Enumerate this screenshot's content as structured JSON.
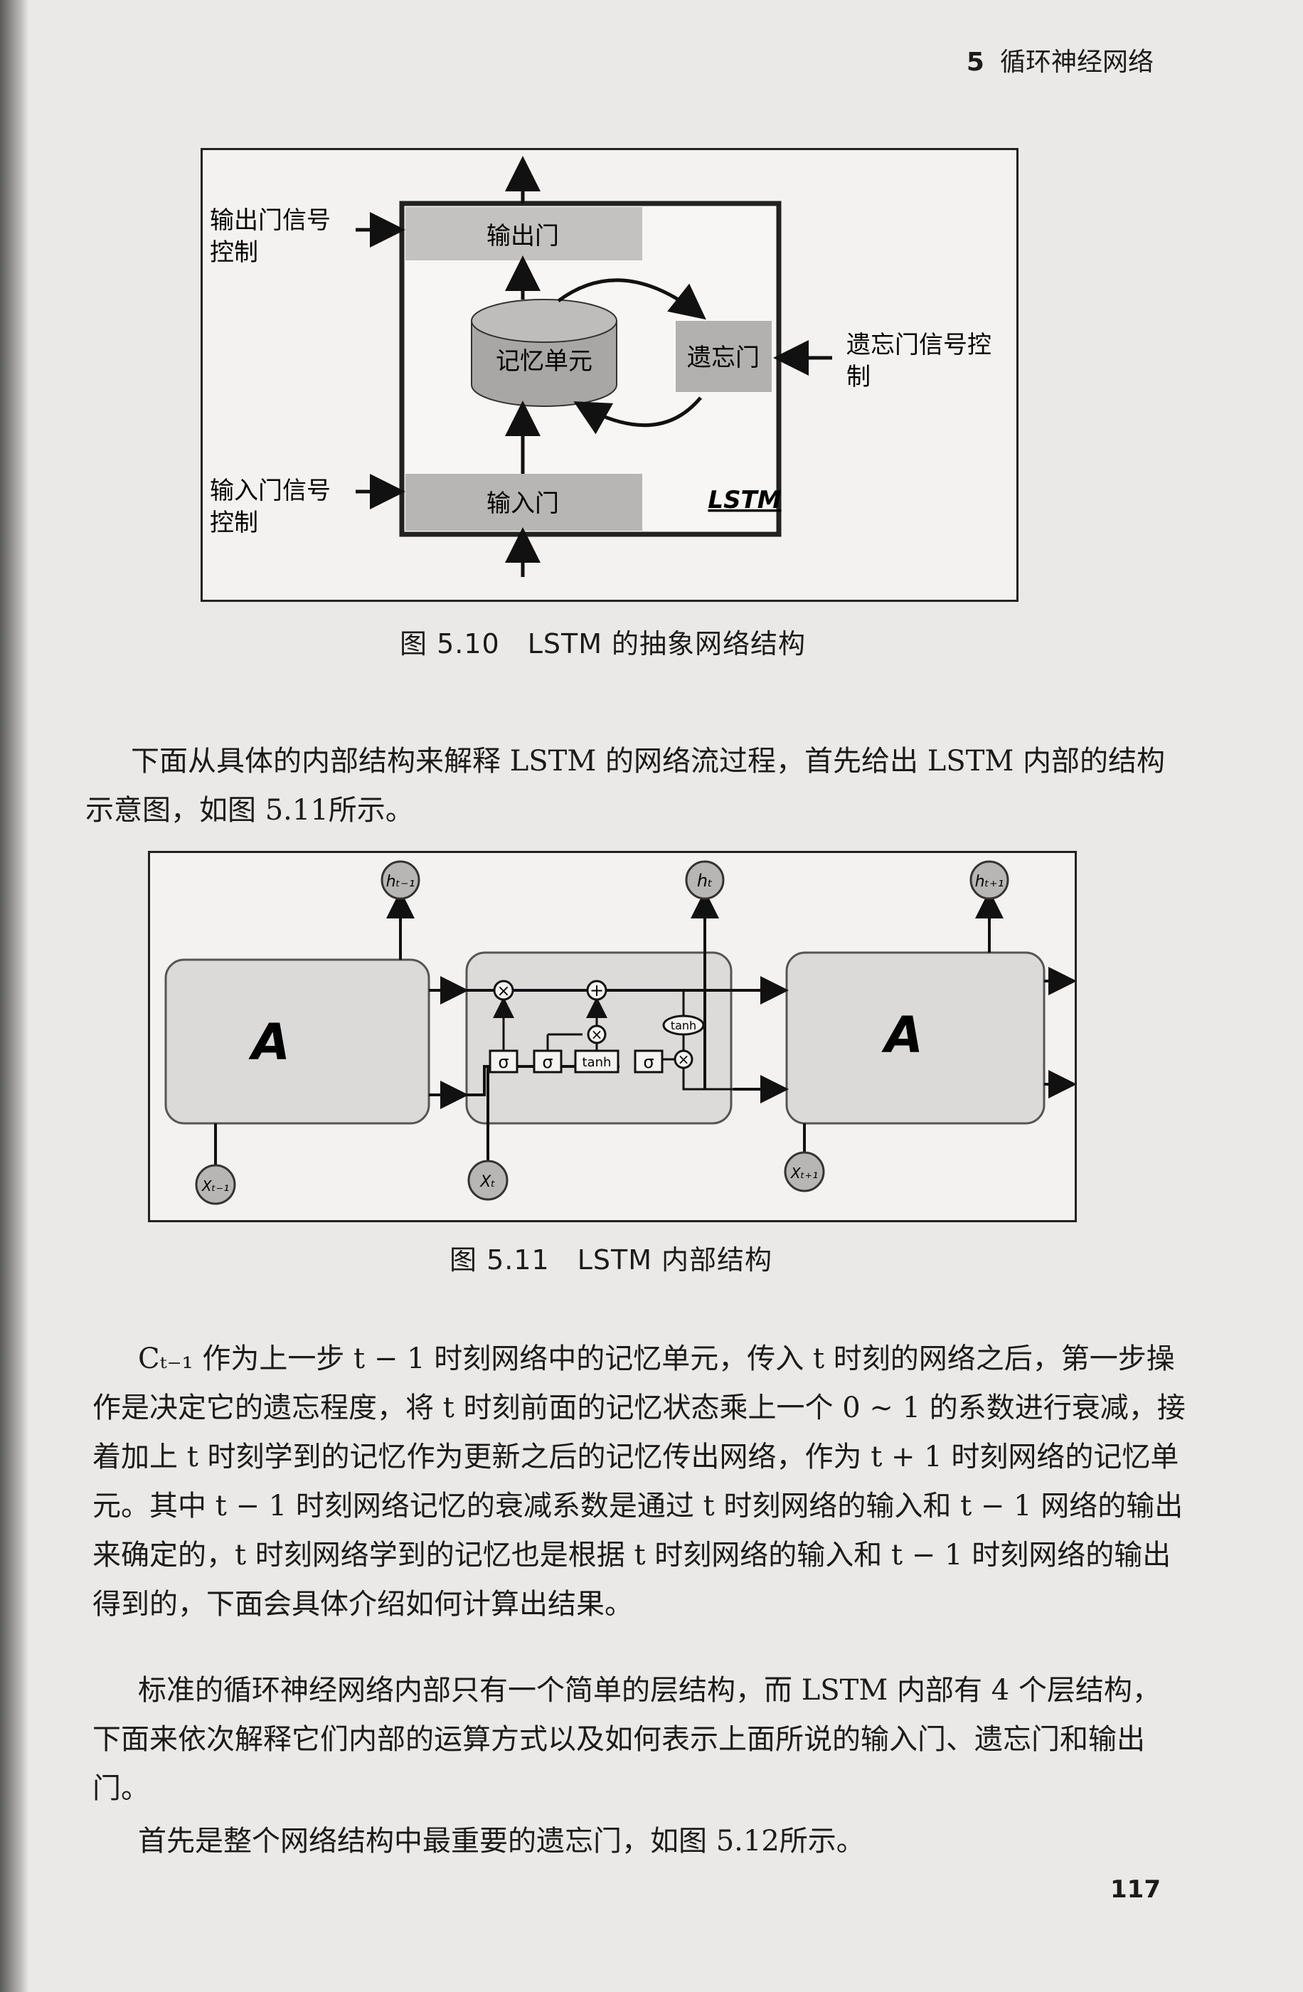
{
  "header": {
    "chapter_num": "5",
    "chapter_title": "循环神经网络"
  },
  "figure_510": {
    "caption": "图 5.10　LSTM 的抽象网络结构",
    "labels": {
      "output_gate": "输出门",
      "memory_cell": "记忆单元",
      "forget_gate": "遗忘门",
      "input_gate": "输入门",
      "lstm": "LSTM",
      "output_ctrl_1": "输出门信号",
      "output_ctrl_2": "控制",
      "input_ctrl_1": "输入门信号",
      "input_ctrl_2": "控制",
      "forget_ctrl_1": "遗忘门信号控",
      "forget_ctrl_2": "制"
    }
  },
  "intro_paragraph": "下面从具体的内部结构来解释 LSTM 的网络流过程，首先给出 LSTM 内部的结构示意图，如图 5.11所示。",
  "figure_511": {
    "caption": "图 5.11　LSTM 内部结构",
    "module_label": "A",
    "h_prev": "hₜ₋₁",
    "h_cur": "hₜ",
    "h_next": "hₜ₊₁",
    "x_prev": "Xₜ₋₁",
    "x_cur": "Xₜ",
    "x_next": "Xₜ₊₁",
    "sigma": "σ",
    "tanh": "tanh",
    "mult": "×",
    "plus": "+"
  },
  "paragraphs": [
    "Cₜ₋₁ 作为上一步 t − 1 时刻网络中的记忆单元，传入 t 时刻的网络之后，第一步操作是决定它的遗忘程度，将 t 时刻前面的记忆状态乘上一个 0 ∼ 1 的系数进行衰减，接着加上 t 时刻学到的记忆作为更新之后的记忆传出网络，作为 t + 1 时刻网络的记忆单元。其中 t − 1 时刻网络记忆的衰减系数是通过 t 时刻网络的输入和 t − 1 网络的输出来确定的，t 时刻网络学到的记忆也是根据 t 时刻网络的输入和 t − 1 时刻网络的输出得到的，下面会具体介绍如何计算出结果。",
    "标准的循环神经网络内部只有一个简单的层结构，而 LSTM 内部有 4 个层结构，下面来依次解释它们内部的运算方式以及如何表示上面所说的输入门、遗忘门和输出门。",
    "首先是整个网络结构中最重要的遗忘门，如图 5.12所示。"
  ],
  "page_number": "117"
}
